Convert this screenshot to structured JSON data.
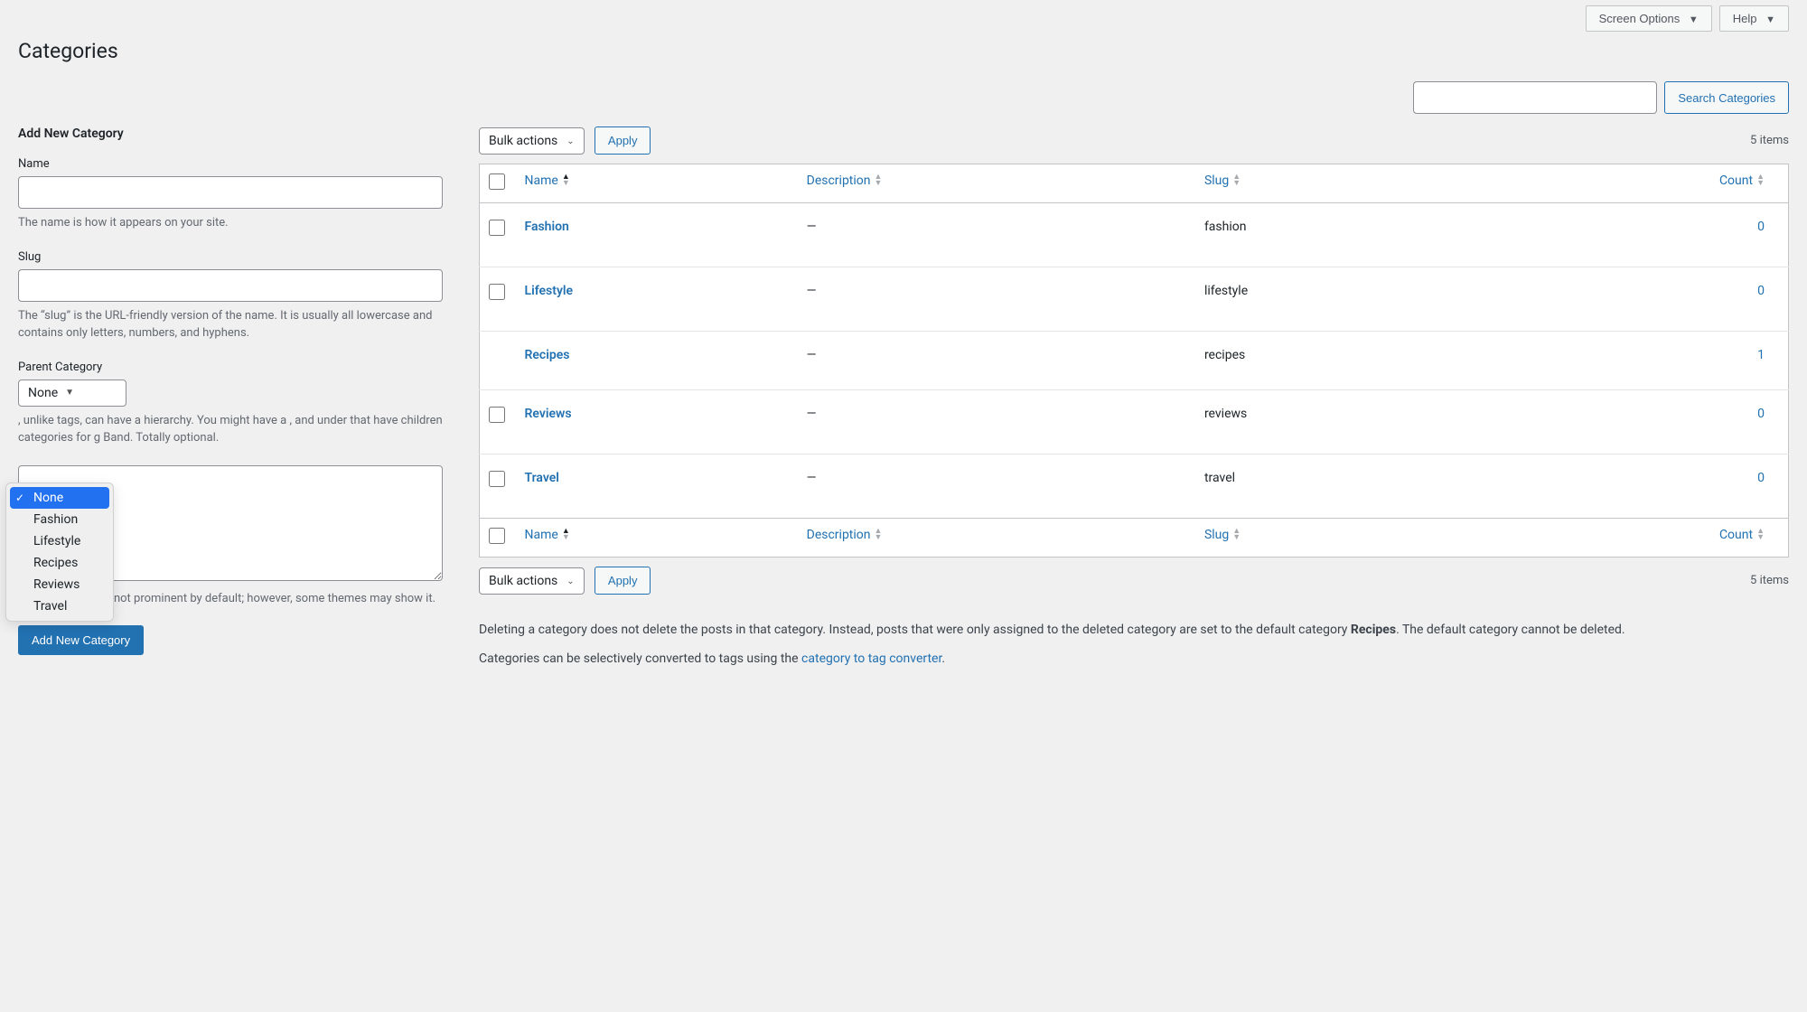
{
  "topbar": {
    "screen_options": "Screen Options",
    "help": "Help"
  },
  "page_title": "Categories",
  "search": {
    "button": "Search Categories"
  },
  "form": {
    "heading": "Add New Category",
    "name_label": "Name",
    "name_help": "The name is how it appears on your site.",
    "slug_label": "Slug",
    "slug_help": "The “slug” is the URL-friendly version of the name. It is usually all lowercase and contains only letters, numbers, and hyphens.",
    "parent_label": "Parent Category",
    "parent_selected": "None",
    "parent_help": ", unlike tags, can have a hierarchy. You might have a , and under that have children categories for g Band. Totally optional.",
    "desc_help": "The description is not prominent by default; however, some themes may show it.",
    "submit": "Add New Category"
  },
  "dropdown": {
    "options": [
      {
        "label": "None",
        "selected": true
      },
      {
        "label": "Fashion",
        "selected": false
      },
      {
        "label": "Lifestyle",
        "selected": false
      },
      {
        "label": "Recipes",
        "selected": false
      },
      {
        "label": "Reviews",
        "selected": false
      },
      {
        "label": "Travel",
        "selected": false
      }
    ]
  },
  "bulk": {
    "label": "Bulk actions",
    "apply": "Apply"
  },
  "items_count": "5 items",
  "table": {
    "headers": {
      "name": "Name",
      "description": "Description",
      "slug": "Slug",
      "count": "Count"
    },
    "rows": [
      {
        "name": "Fashion",
        "description": "—",
        "slug": "fashion",
        "count": "0",
        "indent": false
      },
      {
        "name": "Lifestyle",
        "description": "—",
        "slug": "lifestyle",
        "count": "0",
        "indent": false
      },
      {
        "name": "Recipes",
        "description": "—",
        "slug": "recipes",
        "count": "1",
        "indent": true
      },
      {
        "name": "Reviews",
        "description": "—",
        "slug": "reviews",
        "count": "0",
        "indent": false
      },
      {
        "name": "Travel",
        "description": "—",
        "slug": "travel",
        "count": "0",
        "indent": false
      }
    ]
  },
  "notes": {
    "delete_pre": "Deleting a category does not delete the posts in that category. Instead, posts that were only assigned to the deleted category are set to the default category ",
    "delete_bold": "Recipes",
    "delete_post": ". The default category cannot be deleted.",
    "convert_pre": "Categories can be selectively converted to tags using the ",
    "convert_link": "category to tag converter",
    "convert_post": "."
  }
}
